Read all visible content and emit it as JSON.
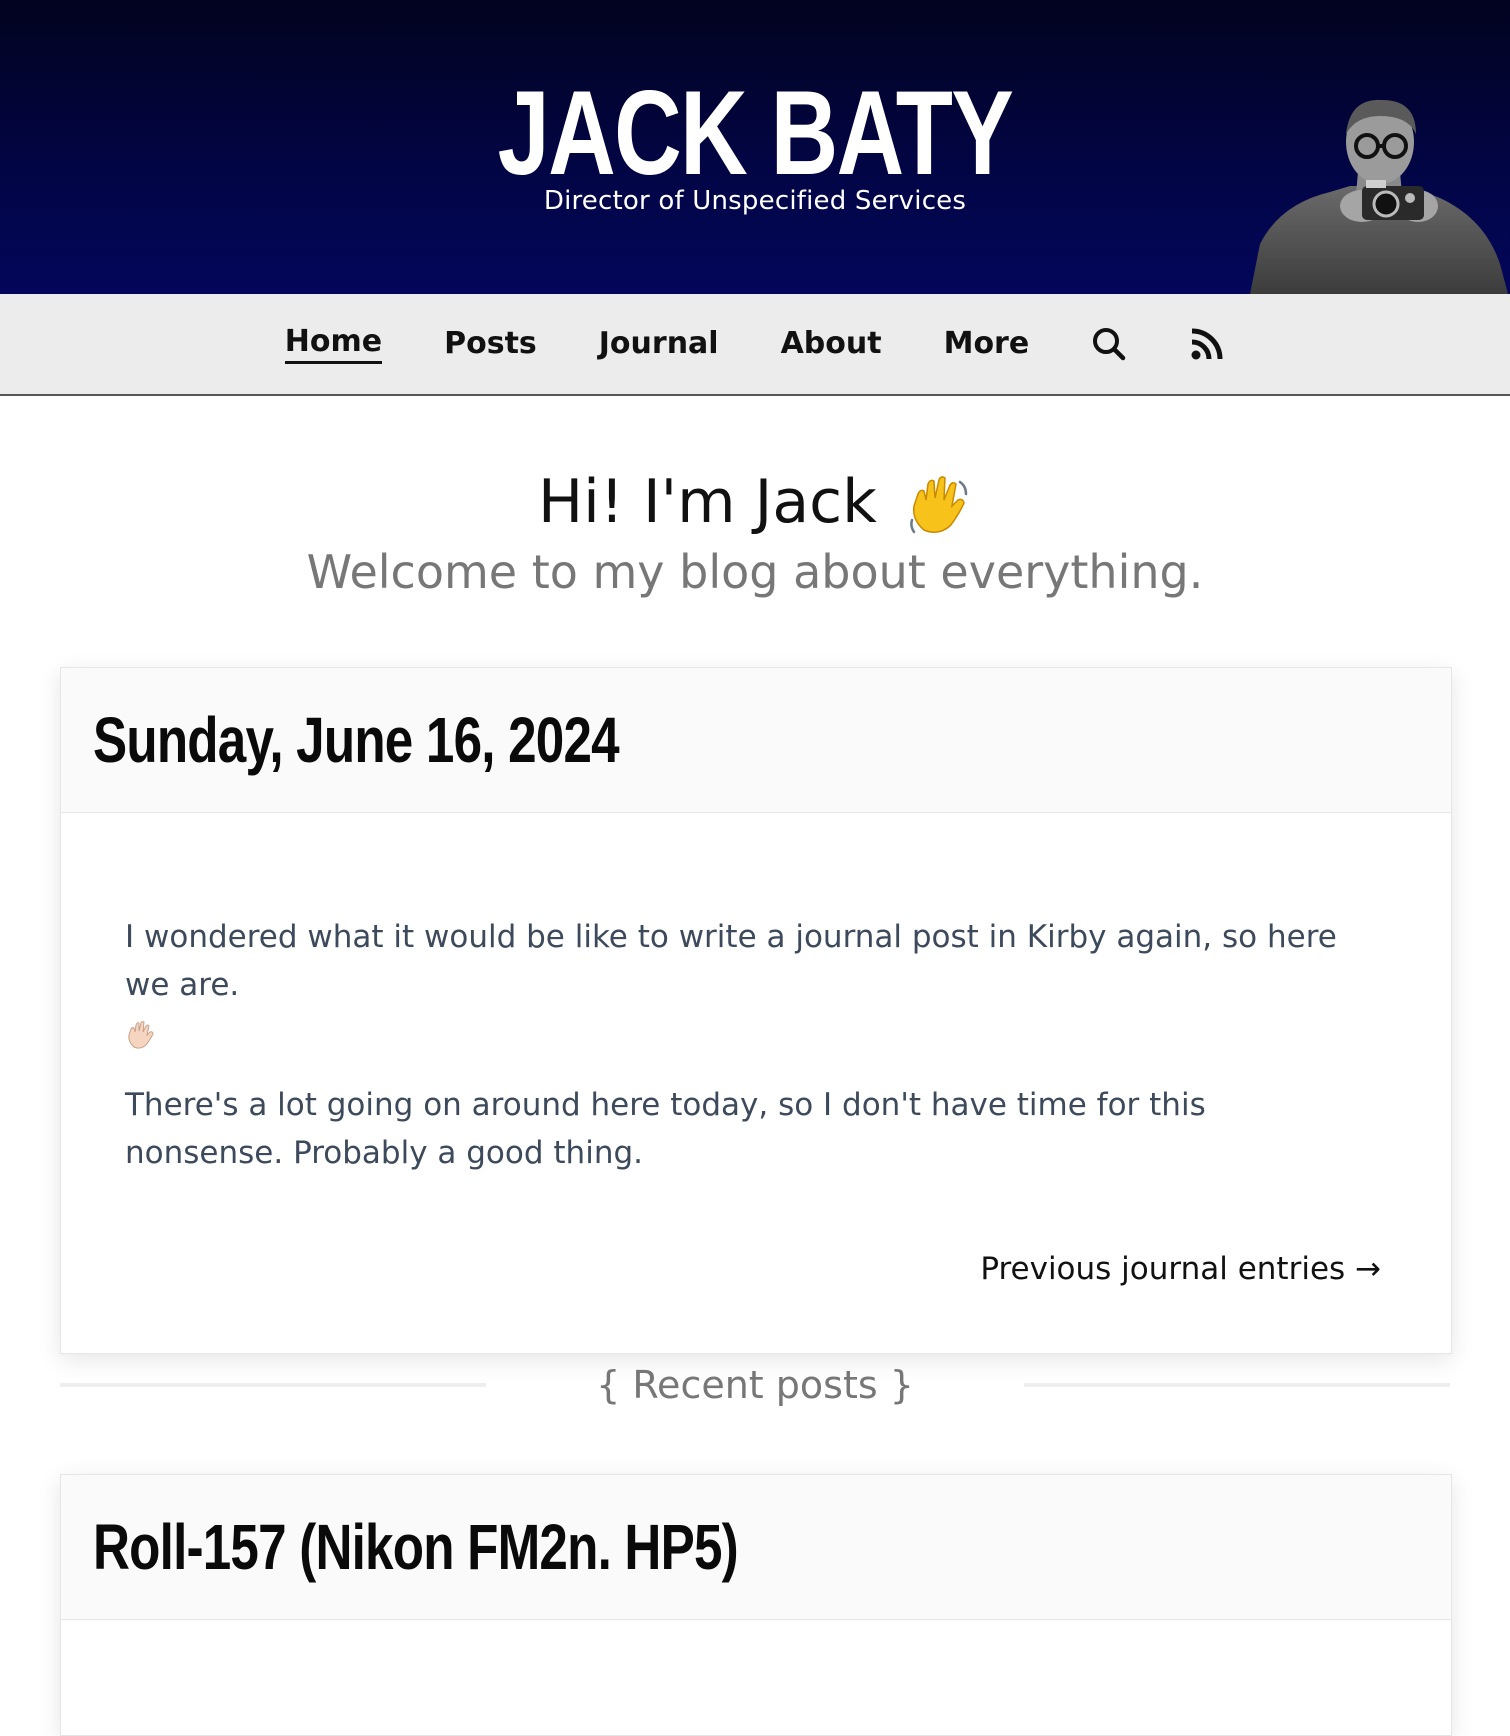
{
  "header": {
    "title": "JACK BATY",
    "tagline": "Director of Unspecified Services",
    "background_color": "#020543"
  },
  "nav": {
    "items": [
      {
        "label": "Home",
        "active": true
      },
      {
        "label": "Posts"
      },
      {
        "label": "Journal"
      },
      {
        "label": "About"
      },
      {
        "label": "More"
      }
    ],
    "search_icon": "search-icon",
    "rss_icon": "rss-icon"
  },
  "hero": {
    "title": "Hi! I'm Jack",
    "emoji": "waving-hand-icon",
    "subtitle": "Welcome to my blog about everything."
  },
  "journal": {
    "date": "Sunday, June 16, 2024",
    "paragraph1": "I wondered what it would be like to write a journal post in Kirby again, so here we are.",
    "paragraph2": "There's a lot going on around here today, so I don't have time for this nonsense. Probably a good thing.",
    "more_link": "Previous journal entries →"
  },
  "recent": {
    "heading": "{ Recent posts }",
    "first_post_title": "Roll-157 (Nikon FM2n. HP5)"
  }
}
